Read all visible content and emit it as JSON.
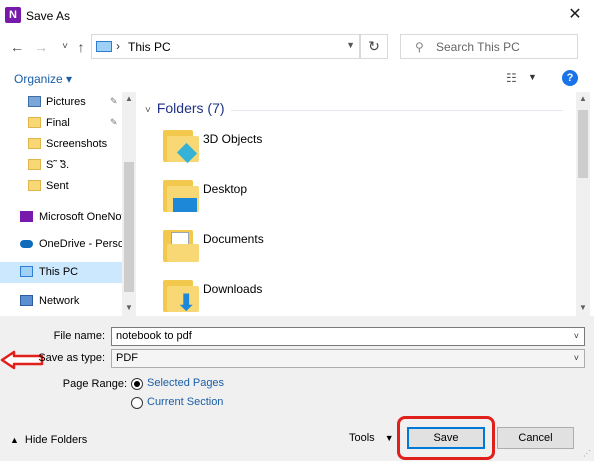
{
  "window": {
    "title": "Save As",
    "app_icon_letter": "N",
    "close_glyph": "✕"
  },
  "nav": {
    "back": "←",
    "forward": "→",
    "recent": "˅",
    "up": "↑",
    "address_sep": "›",
    "address": "This PC",
    "refresh": "↻",
    "search_placeholder": "Search This PC"
  },
  "toolbar": {
    "organize_label": "Organize ▾",
    "help_label": "?"
  },
  "sidebar": {
    "items": [
      {
        "label": "Pictures",
        "icon": "pictures-icon",
        "pinned": true
      },
      {
        "label": "Final",
        "icon": "folder-icon",
        "pinned": true
      },
      {
        "label": "Screenshots",
        "icon": "folder-icon",
        "pinned": false
      },
      {
        "label": "S˜ ̃3.",
        "icon": "folder-icon",
        "pinned": false
      },
      {
        "label": "Sent",
        "icon": "folder-icon",
        "pinned": false
      },
      {
        "label": "Microsoft OneNote",
        "icon": "onenote-icon",
        "pinned": false
      },
      {
        "label": "OneDrive - Personal",
        "icon": "onedrive-icon",
        "pinned": false
      },
      {
        "label": "This PC",
        "icon": "this-pc-icon",
        "pinned": false,
        "selected": true
      },
      {
        "label": "Network",
        "icon": "network-icon",
        "pinned": false
      }
    ],
    "pin_glyph": "📌"
  },
  "main": {
    "section_title": "Folders (7)",
    "section_chevron": "˅",
    "folders": [
      {
        "name": "3D Objects",
        "icon": "3d-objects-folder-icon"
      },
      {
        "name": "Desktop",
        "icon": "desktop-folder-icon"
      },
      {
        "name": "Documents",
        "icon": "documents-folder-icon"
      },
      {
        "name": "Downloads",
        "icon": "downloads-folder-icon"
      }
    ]
  },
  "form": {
    "file_name_label": "File name:",
    "file_name_value": "notebook to pdf",
    "save_type_label": "Save as type:",
    "save_type_value": "PDF",
    "page_range_label": "Page Range:",
    "range_options": [
      {
        "label": "Selected Pages",
        "selected": true
      },
      {
        "label": "Current Section",
        "selected": false
      }
    ]
  },
  "footer": {
    "hide_folders_label": "Hide Folders",
    "tools_label": "Tools",
    "save_label": "Save",
    "cancel_label": "Cancel"
  },
  "colors": {
    "annotation_red": "#e0201b",
    "accent_blue": "#0078d7",
    "onenote_purple": "#7719aa"
  }
}
